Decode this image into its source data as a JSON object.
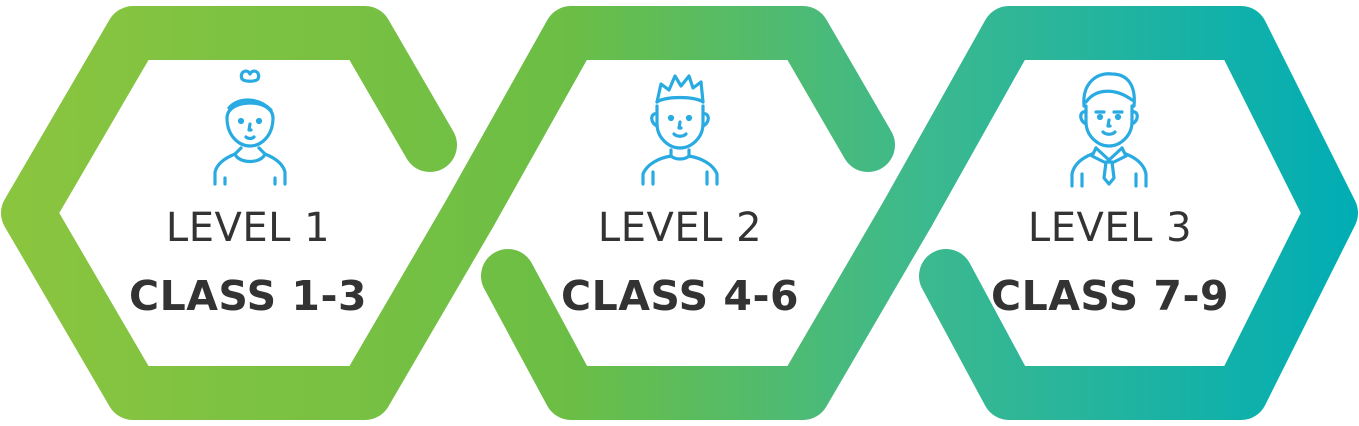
{
  "colors": {
    "gradient_start": "#8BC53F",
    "gradient_mid": "#6BBE45",
    "gradient_end": "#00ADB5",
    "icon_stroke": "#29ABE2",
    "text": "#333333"
  },
  "levels": [
    {
      "level_label": "LEVEL 1",
      "class_label": "CLASS 1-3",
      "icon": "girl-avatar-icon"
    },
    {
      "level_label": "LEVEL 2",
      "class_label": "CLASS 4-6",
      "icon": "boy-avatar-icon"
    },
    {
      "level_label": "LEVEL 3",
      "class_label": "CLASS 7-9",
      "icon": "young-man-tie-avatar-icon"
    }
  ]
}
